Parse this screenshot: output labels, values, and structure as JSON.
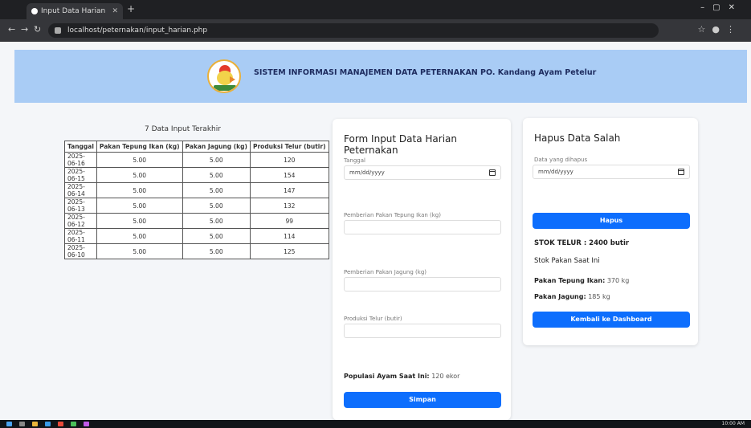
{
  "browser": {
    "tab_title": "Input Data Harian",
    "url": "localhost/peternakan/input_harian.php"
  },
  "header": {
    "title_bold": "SISTEM INFORMASI MANAJEMEN DATA PETERNAKAN PO. Kandang Ayam Petelur",
    "logo_icon": "chicken-logo-icon"
  },
  "recent_table": {
    "title": "7 Data Input Terakhir",
    "columns": [
      "Tanggal",
      "Pakan Tepung Ikan (kg)",
      "Pakan Jagung (kg)",
      "Produksi Telur (butir)"
    ],
    "rows": [
      [
        "2025-06-16",
        "5.00",
        "5.00",
        "120"
      ],
      [
        "2025-06-15",
        "5.00",
        "5.00",
        "154"
      ],
      [
        "2025-06-14",
        "5.00",
        "5.00",
        "147"
      ],
      [
        "2025-06-13",
        "5.00",
        "5.00",
        "132"
      ],
      [
        "2025-06-12",
        "5.00",
        "5.00",
        "99"
      ],
      [
        "2025-06-11",
        "5.00",
        "5.00",
        "114"
      ],
      [
        "2025-06-10",
        "5.00",
        "5.00",
        "125"
      ]
    ]
  },
  "form": {
    "title": "Form Input Data Harian Peternakan",
    "date_label": "Tanggal",
    "date_value": "mm/dd/yyyy",
    "fish_label": "Pemberian Pakan Tepung Ikan (kg)",
    "corn_label": "Pemberian Pakan Jagung (kg)",
    "egg_label": "Produksi Telur (butir)",
    "population_label": "Populasi Ayam Saat Ini:",
    "population_value": "120 ekor",
    "submit_label": "Simpan"
  },
  "delete_panel": {
    "title": "Hapus Data Salah",
    "date_label": "Data yang dihapus",
    "date_value": "mm/dd/yyyy",
    "delete_label": "Hapus",
    "stock_egg": "STOK TELUR : 2400 butir",
    "stock_feed_title": "Stok Pakan Saat Ini",
    "fish_label": "Pakan Tepung Ikan:",
    "fish_value": "370 kg",
    "corn_label": "Pakan Jagung:",
    "corn_value": "185 kg",
    "back_label": "Kembali ke Dashboard"
  },
  "taskbar": {
    "clock": "10:00 AM"
  }
}
